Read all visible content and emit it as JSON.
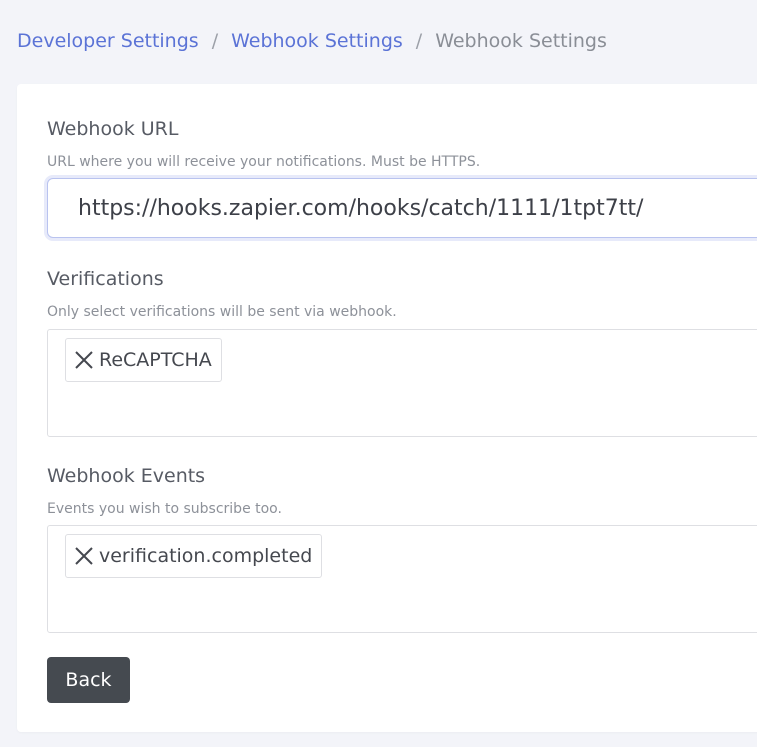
{
  "breadcrumb": {
    "items": [
      "Developer Settings",
      "Webhook Settings",
      "Webhook Settings"
    ],
    "separator": "/"
  },
  "webhook_url": {
    "label": "Webhook URL",
    "help": "URL where you will receive your notifications. Must be HTTPS.",
    "value": "https://hooks.zapier.com/hooks/catch/1111/1tpt7tt/"
  },
  "verifications": {
    "label": "Verifications",
    "help": "Only select verifications will be sent via webhook.",
    "tags": [
      "ReCAPTCHA"
    ]
  },
  "webhook_events": {
    "label": "Webhook Events",
    "help": "Events you wish to subscribe too.",
    "tags": [
      "verification.completed"
    ]
  },
  "actions": {
    "back_label": "Back"
  },
  "colors": {
    "link": "#5b73d6",
    "button_bg": "#454a50",
    "page_bg": "#f3f4f9"
  },
  "icons": {
    "tag_remove": "close-icon"
  }
}
